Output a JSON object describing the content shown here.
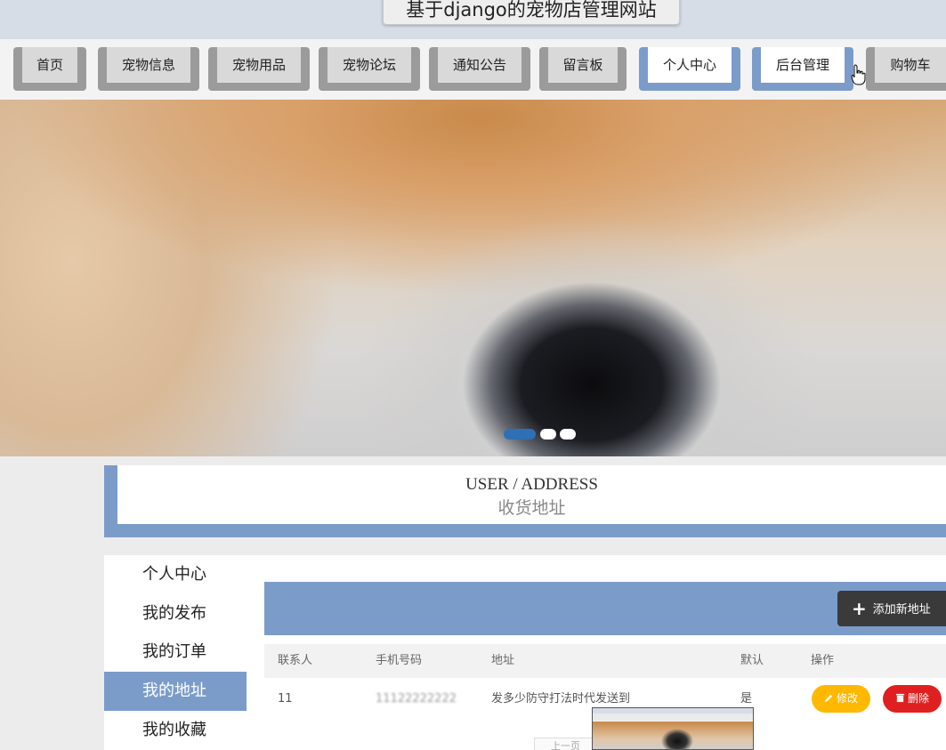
{
  "site": {
    "title": "基于django的宠物店管理网站"
  },
  "nav": {
    "items": [
      {
        "label": "首页"
      },
      {
        "label": "宠物信息"
      },
      {
        "label": "宠物用品"
      },
      {
        "label": "宠物论坛"
      },
      {
        "label": "通知公告"
      },
      {
        "label": "留言板"
      },
      {
        "label": "个人中心",
        "active": true
      },
      {
        "label": "后台管理",
        "active": true
      },
      {
        "label": "购物车"
      }
    ]
  },
  "banner": {
    "slide_count": 3,
    "active_slide": 1
  },
  "section": {
    "title_en": "USER / ADDRESS",
    "title_cn": "收货地址"
  },
  "sidebar": {
    "items": [
      {
        "label": "个人中心"
      },
      {
        "label": "我的发布"
      },
      {
        "label": "我的订单"
      },
      {
        "label": "我的地址",
        "active": true
      },
      {
        "label": "我的收藏"
      }
    ]
  },
  "toolbar": {
    "add_label": "添加新地址",
    "add_icon": "plus-icon"
  },
  "table": {
    "headers": [
      "联系人",
      "手机号码",
      "地址",
      "默认",
      "操作"
    ],
    "rows": [
      {
        "contact": "11",
        "phone": "11122222222",
        "address": "发多少防守打法时代发送到",
        "default": "是"
      }
    ],
    "edit_label": "修改",
    "delete_label": "删除",
    "edit_icon": "pencil-icon",
    "delete_icon": "trash-icon"
  },
  "pager": {
    "label": "上一页"
  },
  "colors": {
    "accent": "#7b9cc9",
    "edit": "#ffb800",
    "delete": "#e02020",
    "dark_button": "#3a3a3a",
    "slide_active": "#2f6fb5"
  }
}
